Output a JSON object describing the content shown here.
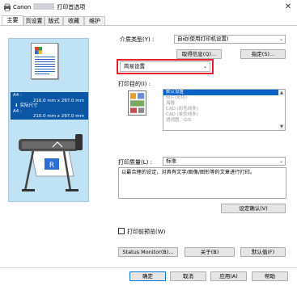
{
  "window": {
    "app_name": "Canon",
    "title": "打印首选项",
    "close_glyph": "✕"
  },
  "tabs": [
    {
      "label": "主要"
    },
    {
      "label": "页设置"
    },
    {
      "label": "版式"
    },
    {
      "label": "收藏"
    },
    {
      "label": "维护"
    }
  ],
  "preview": {
    "paper_size_1": "A4 :",
    "dims_1": "210.0 mm x 297.0 mm",
    "actual_size": "实际尺寸",
    "paper_size_2": "A4 :",
    "dims_2": "210.0 mm x 297.0 mm"
  },
  "media": {
    "label": "介质类型(Y) :",
    "value": "自动(使用打印机设置)",
    "get_info_button": "取得信息(Q)...",
    "specify_button": "指定(S)..."
  },
  "mode": {
    "value": "简易设置"
  },
  "purpose": {
    "label": "打印目的(I) :",
    "items": [
      "默认设置",
      "照片(彩色)",
      "海报",
      "CAD (彩色线条)",
      "CAD (单色线条)",
      "透视图、GIS"
    ],
    "selected_index": 0
  },
  "quality": {
    "label": "打印质量(L) :",
    "value": "标准",
    "description": "以最合理的设定，对具有文字/图像/图形等的文章进行打印。",
    "confirm_button": "设定确认(V)"
  },
  "preview_check": {
    "label": "打印前预览(W)",
    "checked": false
  },
  "bottom": {
    "status_monitor": "Status Monitor(B)...",
    "about": "关于(B)",
    "defaults": "默认值(F)"
  },
  "footer": {
    "ok": "确定",
    "cancel": "取消",
    "apply": "应用(A)",
    "help": "帮助"
  },
  "colors": {
    "accent": "#0b57a5",
    "selection": "#0a64c8",
    "highlight_frame": "#e8202a",
    "preview_bg": "#bfe3f5"
  }
}
